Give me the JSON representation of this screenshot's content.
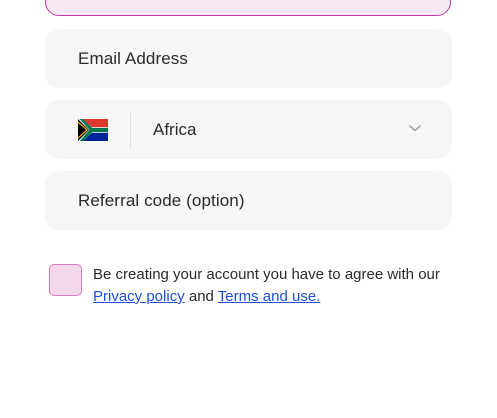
{
  "form": {
    "email": {
      "placeholder": "Email Address"
    },
    "country": {
      "flag_icon": "south-africa-flag-icon",
      "name": "Africa",
      "chevron_icon": "chevron-down-icon"
    },
    "referral": {
      "placeholder": "Referral code (option)"
    },
    "agreement": {
      "text_before": "Be creating your account you have to agree with our ",
      "privacy_link": "Privacy policy",
      "text_middle": " and ",
      "terms_link": "Terms and use."
    }
  },
  "colors": {
    "accent": "#c33aa0",
    "checkbox_fill": "#f3d8ec",
    "field_bg": "#f6f6f6",
    "link": "#1f4fd6"
  }
}
